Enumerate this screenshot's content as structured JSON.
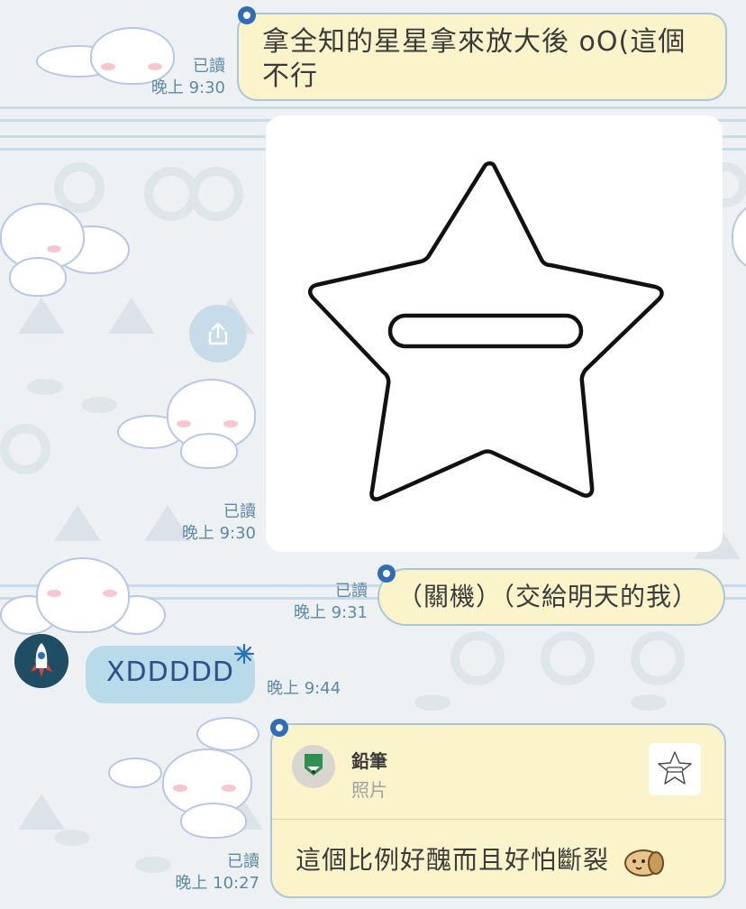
{
  "messages": {
    "m1": {
      "text_line1": "拿全知的星星拿來放大後 oO(這個",
      "text_line2": "不行",
      "read": "已讀",
      "time": "晚上 9:30"
    },
    "m2": {
      "read": "已讀",
      "time": "晚上 9:30",
      "image_icon": "star-badge-image"
    },
    "m3": {
      "text": "（關機）（交給明天的我）",
      "read": "已讀",
      "time": "晚上 9:31"
    },
    "m4": {
      "text": "XDDDDD",
      "time": "晚上 9:44",
      "avatar_icon": "rocket-avatar-icon"
    },
    "m5": {
      "reply_name": "鉛筆",
      "reply_type": "照片",
      "text": "這個比例好醜而且好怕斷裂",
      "read": "已讀",
      "time": "晚上 10:27",
      "sticker_icon": "dog-face-emoji"
    }
  },
  "share_icon": "share-icon",
  "colors": {
    "outgoing_bubble": "#fbf3c9",
    "outgoing_border": "#aac7d6",
    "incoming_bubble": "#b9dbe9",
    "incoming_text": "#2f4f89",
    "meta_text": "#5d8aa3"
  }
}
